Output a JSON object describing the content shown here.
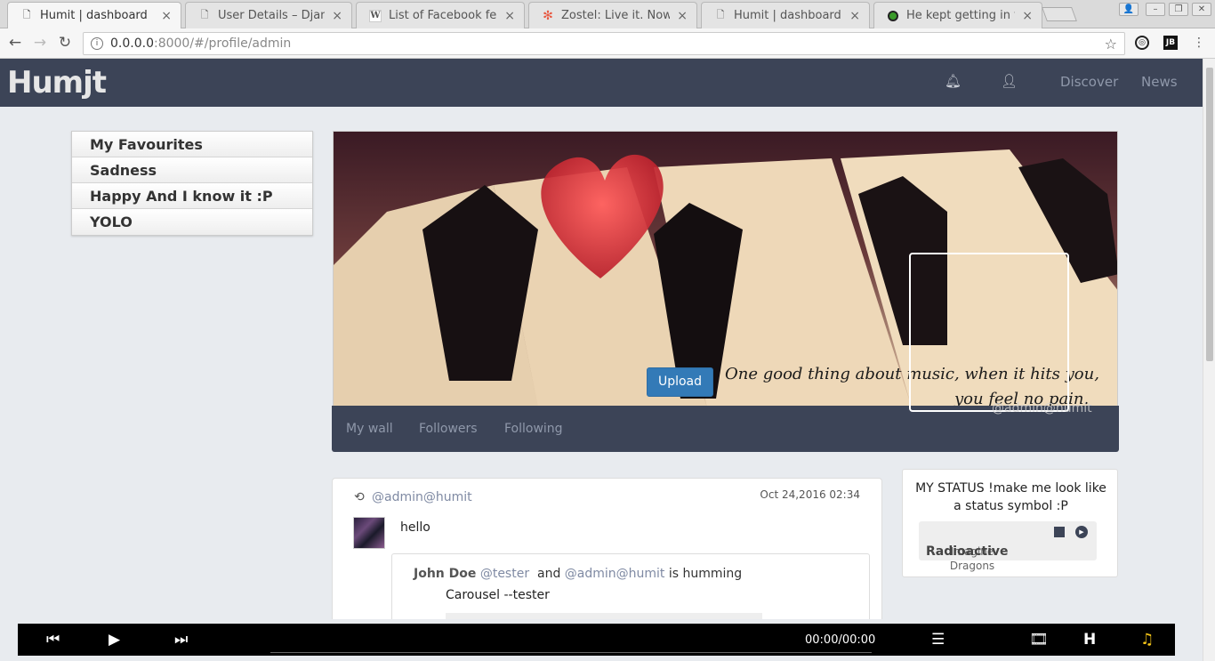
{
  "browser": {
    "tabs": [
      {
        "title": "Humit | dashboard",
        "icon": "page-icon",
        "active": true
      },
      {
        "title": "User Details – Django",
        "icon": "page-icon",
        "active": false
      },
      {
        "title": "List of Facebook featu",
        "icon": "wikipedia-icon",
        "active": false
      },
      {
        "title": "Zostel: Live it. Now: Ir",
        "icon": "zostel-icon",
        "active": false
      },
      {
        "title": "Humit | dashboard",
        "icon": "page-icon",
        "active": false
      },
      {
        "title": "He kept getting in the",
        "icon": "green-circle-icon",
        "active": false
      }
    ],
    "url_host": "0.0.0.0",
    "url_path": ":8000/#/profile/admin"
  },
  "app": {
    "logo": "Humjt",
    "nav": {
      "discover": "Discover",
      "news": "News"
    }
  },
  "playlists": [
    "My Favourites",
    "Sadness",
    "Happy And I know it :P",
    "YOLO"
  ],
  "cover": {
    "quote_line1": "One good thing about music, when it hits you,",
    "quote_line2": "you feel no pain.",
    "upload_label": "Upload",
    "handle": "@admin@humit"
  },
  "profile_tabs": [
    "My wall",
    "Followers",
    "Following"
  ],
  "post": {
    "user": "@admin@humit",
    "time": "Oct 24,2016 02:34",
    "text": "hello",
    "shared": {
      "name": "John Doe",
      "handle": "@tester",
      "and": "and",
      "with": "@admin@humit",
      "action": "is humming",
      "song": "Carousel --tester"
    }
  },
  "status": {
    "text": "MY STATUS !make me look like a status symbol :P",
    "song_title": "Radioactive",
    "song_artist": "Imagine Dragons"
  },
  "player": {
    "time": "00:00/00:00"
  },
  "colors": {
    "header": "#3c4457",
    "accent": "#337ab7",
    "link": "#7f8aa3"
  }
}
